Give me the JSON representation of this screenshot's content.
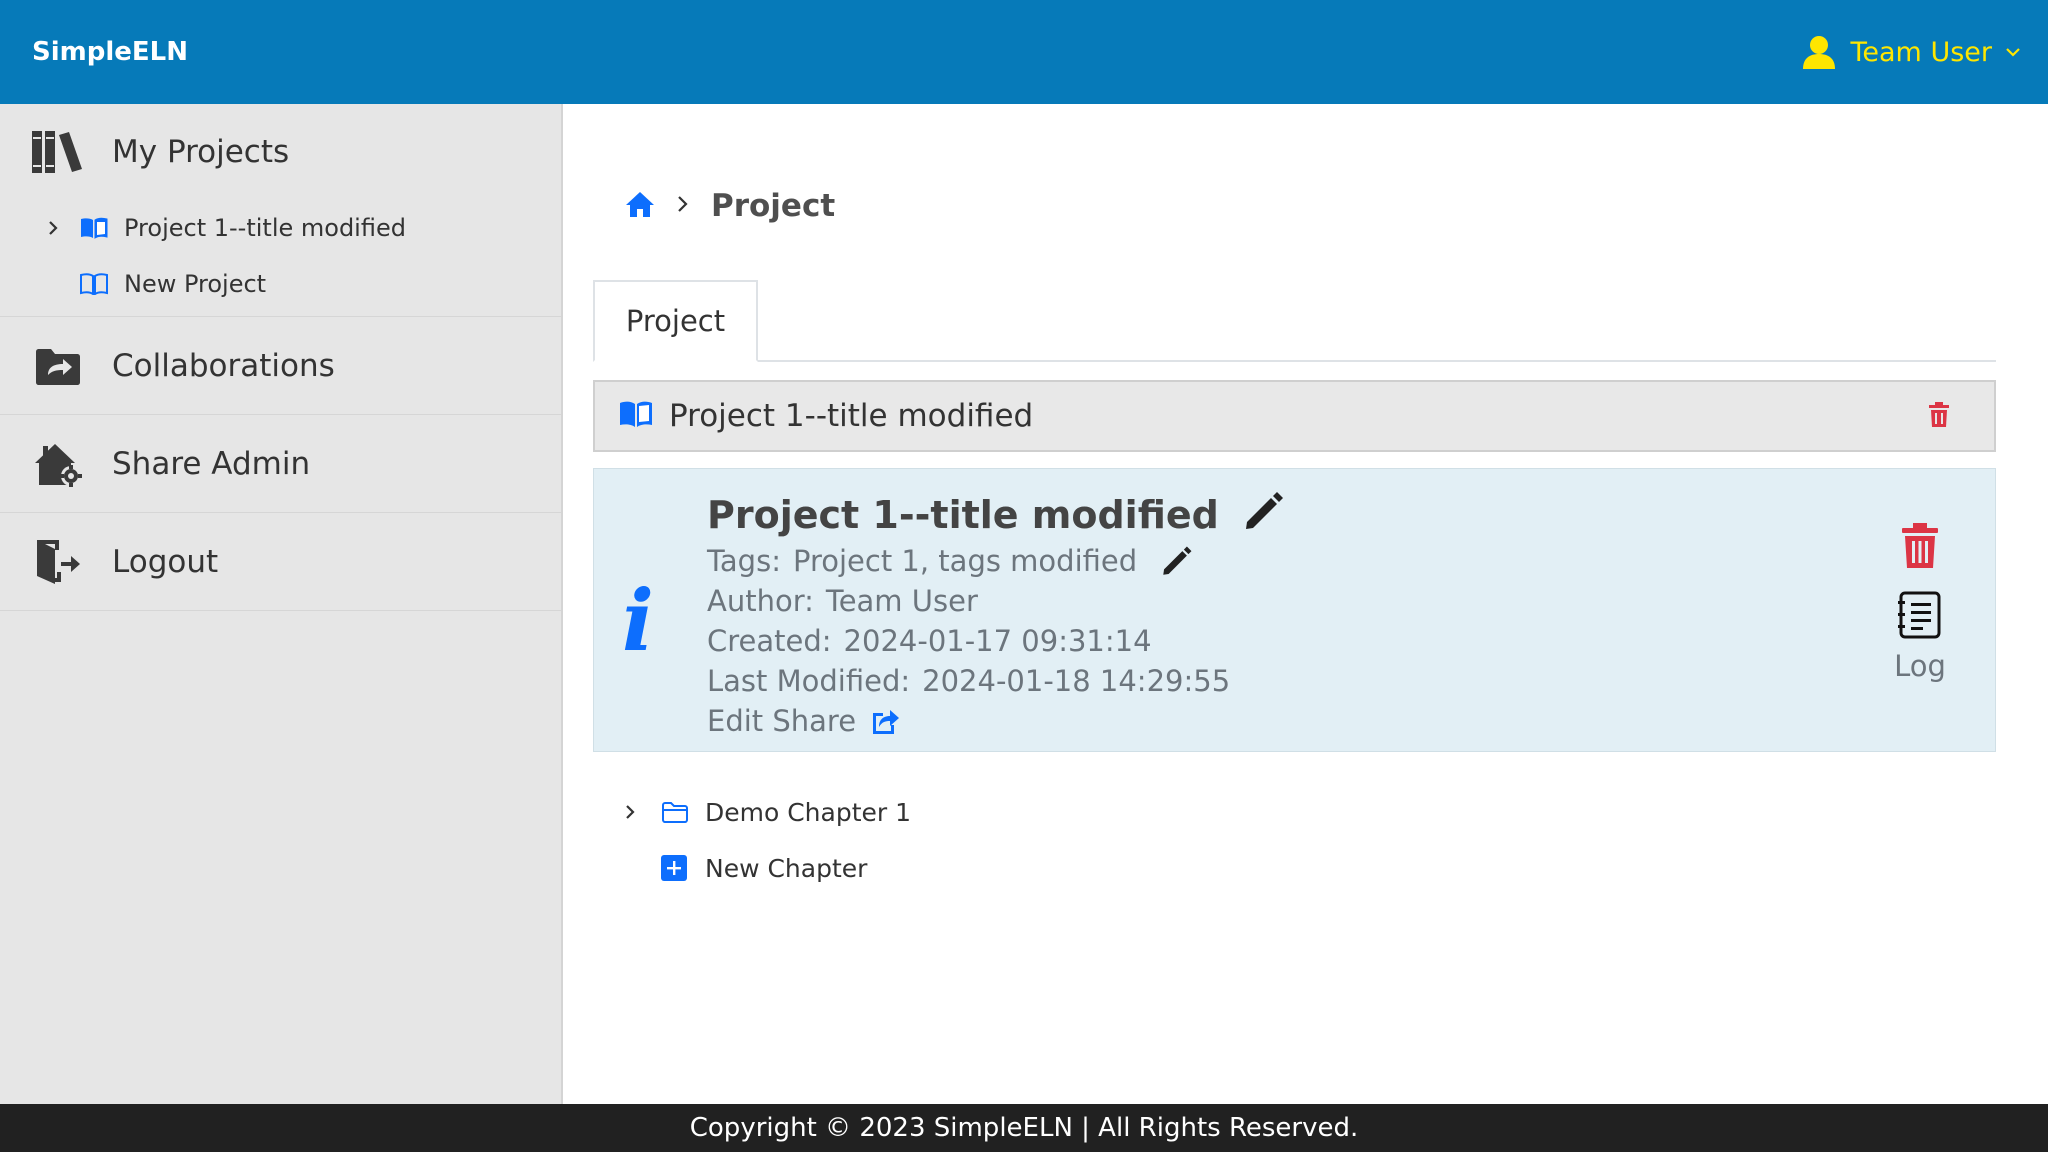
{
  "header": {
    "brand": "SimpleELN",
    "user_name": "Team User",
    "icons": [
      "user-icon",
      "chevron-down-icon"
    ],
    "colors": {
      "bar": "#067ab9",
      "user": "#ffe600"
    }
  },
  "sidebar": {
    "my_projects": {
      "label": "My Projects",
      "icon": "books-icon",
      "items": [
        {
          "label": "Project 1--title modified",
          "icon": "open-book-icon",
          "expandable": true
        },
        {
          "label": "New Project",
          "icon": "open-book-outline-icon",
          "expandable": false
        }
      ]
    },
    "collaborations": {
      "label": "Collaborations",
      "icon": "shared-folder-icon"
    },
    "share_admin": {
      "label": "Share Admin",
      "icon": "house-gear-icon"
    },
    "logout": {
      "label": "Logout",
      "icon": "logout-door-icon"
    }
  },
  "breadcrumb": {
    "home_icon": "home-icon",
    "current": "Project"
  },
  "tabs": [
    {
      "label": "Project",
      "active": true
    }
  ],
  "project_bar": {
    "title": "Project 1--title modified",
    "icons": [
      "open-book-icon",
      "trash-icon"
    ]
  },
  "info": {
    "title": "Project 1--title modified",
    "tags_label": "Tags:",
    "tags_value": "Project 1, tags modified",
    "author_label": "Author:",
    "author_value": "Team User",
    "created_label": "Created:",
    "created_value": "2024-01-17 09:31:14",
    "modified_label": "Last Modified:",
    "modified_value": "2024-01-18 14:29:55",
    "edit_share": "Edit Share",
    "log_label": "Log",
    "icons": [
      "info-icon",
      "pencil-icon",
      "share-icon",
      "trash-icon",
      "log-notebook-icon"
    ],
    "colors": {
      "panel": "#e2eff5",
      "accent": "#0d6efd",
      "danger": "#dc3545"
    }
  },
  "chapters": [
    {
      "label": "Demo Chapter 1",
      "icon": "folder-icon",
      "expandable": true
    },
    {
      "label": "New Chapter",
      "icon": "plus-square-icon",
      "expandable": false
    }
  ],
  "footer": {
    "text": "Copyright © 2023 SimpleELN | All Rights Reserved."
  }
}
